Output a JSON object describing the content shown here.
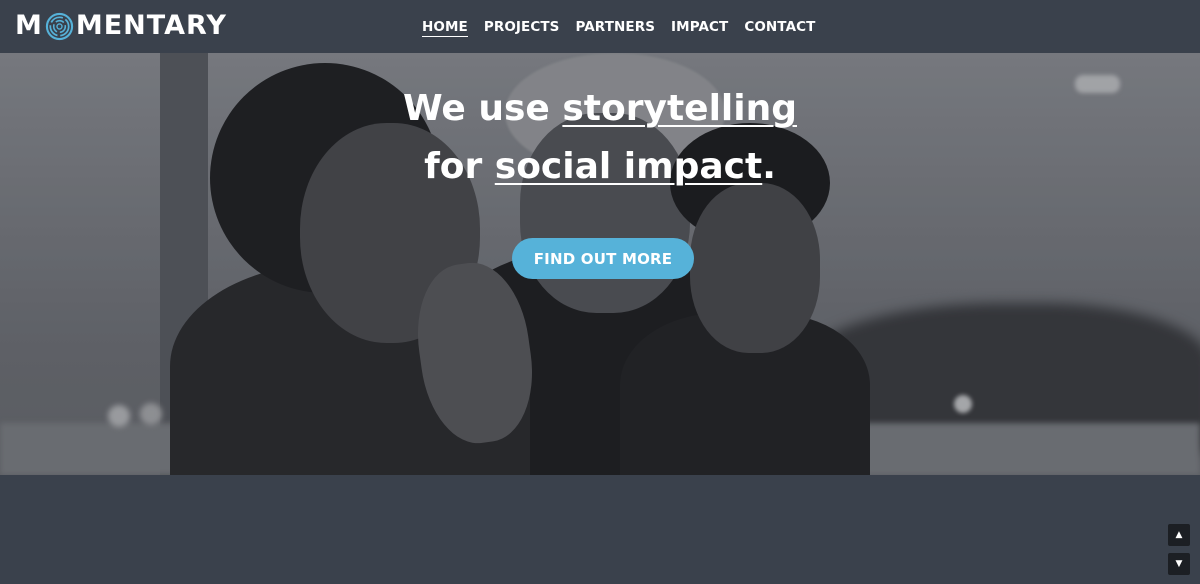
{
  "brand": {
    "logo_first_letter": "M",
    "logo_rest": "MENTARY",
    "logo_mark": "fingerprint-o-icon"
  },
  "nav": {
    "items": [
      {
        "label": "HOME",
        "active": true
      },
      {
        "label": "PROJECTS",
        "active": false
      },
      {
        "label": "PARTNERS",
        "active": false
      },
      {
        "label": "IMPACT",
        "active": false
      },
      {
        "label": "CONTACT",
        "active": false
      }
    ]
  },
  "hero": {
    "line1_prefix": "We use ",
    "line1_emphasis": "storytelling",
    "line2_prefix": "for ",
    "line2_emphasis": "social impact",
    "line2_suffix": ".",
    "cta_label": "FIND OUT MORE"
  },
  "scroll": {
    "up_icon": "▲",
    "down_icon": "▼"
  },
  "colors": {
    "background": "#3a414c",
    "accent": "#56b2d9",
    "text": "#ffffff"
  }
}
